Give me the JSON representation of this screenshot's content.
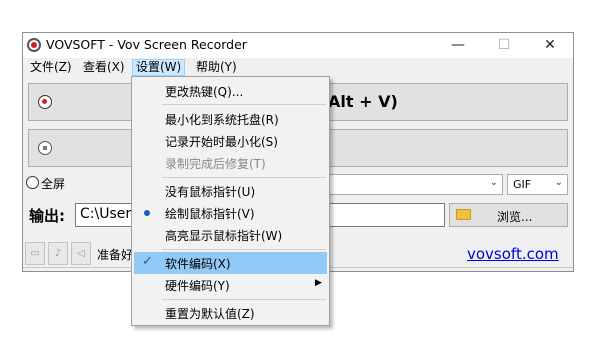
{
  "window": {
    "title": "VOVSOFT - Vov Screen Recorder",
    "controls": {
      "minimize": "—",
      "maximize": "☐",
      "close": "✕"
    }
  },
  "menubar": {
    "file": "文件(Z)",
    "view": "查看(X)",
    "settings": "设置(W)",
    "help": "帮助(Y)"
  },
  "main": {
    "record_label": "Alt + V)",
    "fullscreen_label": "全屏",
    "format_value": "GIF",
    "output_label": "输出:",
    "output_path": "C:\\User",
    "browse_label": "浏览...",
    "status_text": "准备好",
    "site_link": "vovsoft.com"
  },
  "settings_menu": {
    "change_hotkey": "更改热键(Q)...",
    "minimize_to_tray": "最小化到系统托盘(R)",
    "minimize_on_start": "记录开始时最小化(S)",
    "repair_after": "录制完成后修复(T)",
    "no_cursor": "没有鼠标指针(U)",
    "draw_cursor": "绘制鼠标指针(V)",
    "highlight_cursor": "高亮显示鼠标指针(W)",
    "software_encoding": "软件编码(X)",
    "hardware_encoding": "硬件编码(Y)",
    "reset_defaults": "重置为默认值(Z)"
  },
  "colors": {
    "accent": "#0000dd",
    "record_red": "#d42020",
    "highlight": "#91c9f7"
  }
}
